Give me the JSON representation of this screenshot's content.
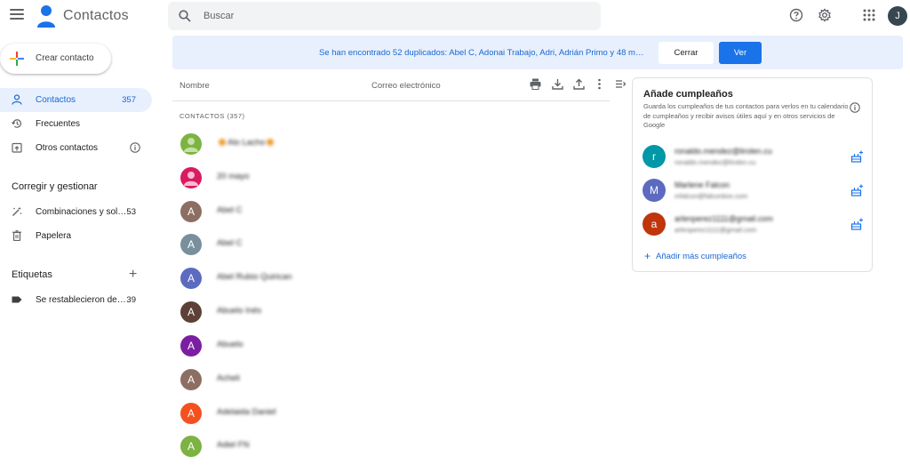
{
  "header": {
    "app_title": "Contactos",
    "search_placeholder": "Buscar",
    "avatar_initial": "J"
  },
  "sidebar": {
    "create_label": "Crear contacto",
    "items": [
      {
        "label": "Contactos",
        "count": "357"
      },
      {
        "label": "Frecuentes",
        "count": ""
      },
      {
        "label": "Otros contactos",
        "count": ""
      }
    ],
    "manage_title": "Corregir y gestionar",
    "manage_items": [
      {
        "label": "Combinaciones y sol…",
        "count": "53"
      },
      {
        "label": "Papelera",
        "count": ""
      }
    ],
    "labels_title": "Etiquetas",
    "labels_add": "+",
    "labels_items": [
      {
        "label": "Se restablecieron de…",
        "count": "39"
      }
    ]
  },
  "banner": {
    "text": "Se han encontrado 52 duplicados: Abel C, Adonai Trabajo, Adri, Adrián Primo y 48 m…",
    "close_label": "Cerrar",
    "view_label": "Ver"
  },
  "table": {
    "col_name": "Nombre",
    "col_email": "Correo electrónico",
    "group_label": "CONTACTOS (357)"
  },
  "contacts": [
    {
      "initial": "",
      "name": "Alo Lacho",
      "color": "#7cb342"
    },
    {
      "initial": "",
      "name": "20 mayo",
      "color": "#d81b60"
    },
    {
      "initial": "A",
      "name": "Abel C",
      "color": "#8d6e63"
    },
    {
      "initial": "A",
      "name": "Abel C",
      "color": "#78909c"
    },
    {
      "initial": "A",
      "name": "Abel Rubio Quirican",
      "color": "#5c6bc0"
    },
    {
      "initial": "A",
      "name": "Abuelo Inés",
      "color": "#5d4037"
    },
    {
      "initial": "A",
      "name": "Abuelo",
      "color": "#7b1fa2"
    },
    {
      "initial": "A",
      "name": "Acheli",
      "color": "#8d6e63"
    },
    {
      "initial": "A",
      "name": "Adelaida Daniel",
      "color": "#f4511e"
    },
    {
      "initial": "A",
      "name": "Adiel FN",
      "color": "#7cb342"
    }
  ],
  "birthdays": {
    "title": "Añade cumpleaños",
    "description": "Guarda los cumpleaños de tus contactos para verlos en tu calendario de cumpleaños y recibir avisos útiles aquí y en otros servicios de Google",
    "people": [
      {
        "initial": "r",
        "name": "ronaldo.mendez@lirolen.cu",
        "email": "ronaldo.mendez@lirolen.cu",
        "color": "#0097a7"
      },
      {
        "initial": "M",
        "name": "Marlene Falcon",
        "email": "mfalcon@falconbox.com",
        "color": "#5c6bc0"
      },
      {
        "initial": "a",
        "name": "arlenperez1111@gmail.com",
        "email": "arlenperez1111@gmail.com",
        "color": "#bf360c"
      }
    ],
    "more_label": "Añadir más cumpleaños"
  },
  "colors": {
    "accent": "#1a73e8",
    "active_nav_bg": "#e8f0fe",
    "banner_text": "#1967d2"
  }
}
